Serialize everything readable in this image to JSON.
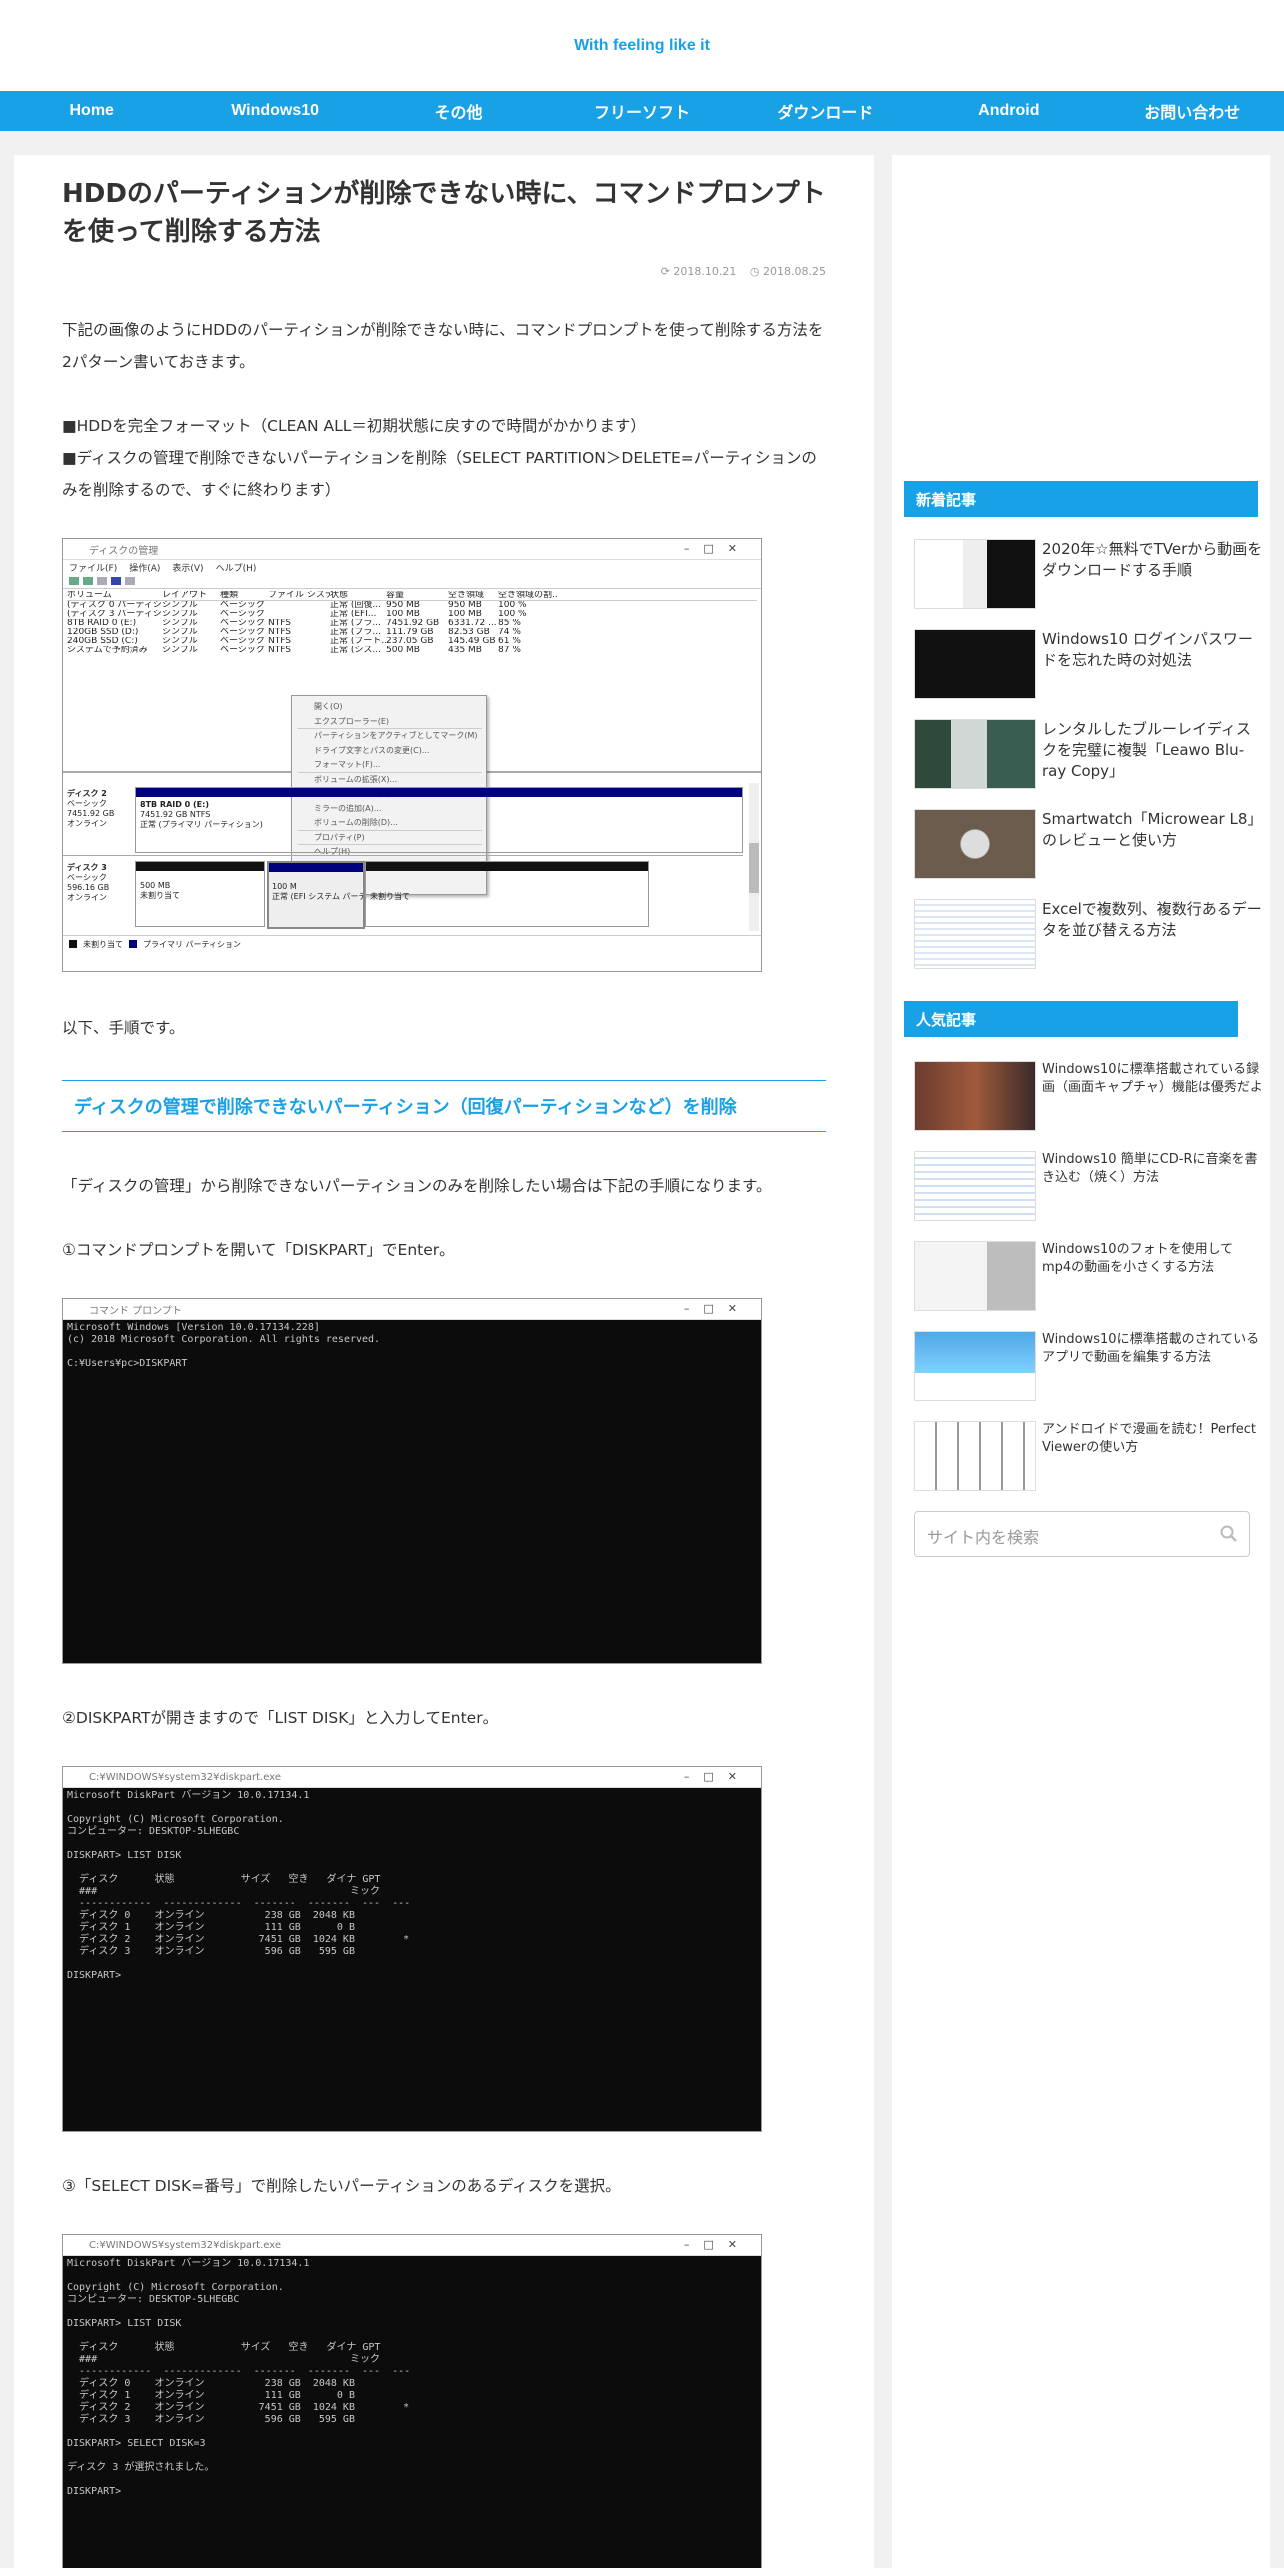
{
  "header": {
    "site_title": "With feeling like it"
  },
  "nav": {
    "items": [
      "Home",
      "Windows10",
      "その他",
      "フリーソフト",
      "ダウンロード",
      "Android",
      "お問い合わせ"
    ]
  },
  "post": {
    "title": "HDDのパーティションが削除できない時に、コマンドプロンプトを使って削除する方法",
    "updated": "2018.10.21",
    "published": "2018.08.25",
    "intro": "下記の画像のようにHDDのパーティションが削除できない時に、コマンドプロンプトを使って削除する方法を2パターン書いておきます。",
    "bullet1": "■HDDを完全フォーマット（CLEAN ALL＝初期状態に戻すので時間がかかります）",
    "bullet2": "■ディスクの管理で削除できないパーティションを削除（SELECT PARTITION＞DELETE=パーティションのみを削除するので、すぐに終わります）",
    "steps_intro": "以下、手順です。",
    "h2": "ディスクの管理で削除できないパーティション（回復パーティションなど）を削除",
    "h2_intro": "「ディスクの管理」から削除できないパーティションのみを削除したい場合は下記の手順になります。",
    "step1": "①コマンドプロンプトを開いて「DISKPART」でEnter。",
    "step2": "②DISKPARTが開きますので「LIST DISK」と入力してEnter。",
    "step3": "③「SELECT DISK=番号」で削除したいパーティションのあるディスクを選択。"
  },
  "diskmgmt": {
    "title": "ディスクの管理",
    "menu": [
      "ファイル(F)",
      "操作(A)",
      "表示(V)",
      "ヘルプ(H)"
    ],
    "columns": [
      "ボリューム",
      "レイアウト",
      "種類",
      "ファイル システム",
      "状態",
      "容量",
      "空き領域",
      "空き領域の割..."
    ],
    "rows": [
      [
        "(ディスク 0 パーティシ...",
        "シンプル",
        "ベーシック",
        "",
        "正常 (回復...",
        "950 MB",
        "950 MB",
        "100 %"
      ],
      [
        "(ディスク 3 パーティシ...",
        "シンプル",
        "ベーシック",
        "",
        "正常 (EFI...",
        "100 MB",
        "100 MB",
        "100 %"
      ],
      [
        "8TB RAID 0 (E:)",
        "シンプル",
        "ベーシック",
        "NTFS",
        "正常 (プラ...",
        "7451.92 GB",
        "6331.72 ...",
        "85 %"
      ],
      [
        "120GB SSD (D:)",
        "シンプル",
        "ベーシック",
        "NTFS",
        "正常 (プラ...",
        "111.79 GB",
        "82.53 GB",
        "74 %"
      ],
      [
        "240GB SSD (C:)",
        "シンプル",
        "ベーシック",
        "NTFS",
        "正常 (ブート...",
        "237.05 GB",
        "145.49 GB",
        "61 %"
      ],
      [
        "システムで予約済み",
        "シンプル",
        "ベーシック",
        "NTFS",
        "正常 (シス...",
        "500 MB",
        "435 MB",
        "87 %"
      ]
    ],
    "context_menu": [
      "開く(O)",
      "エクスプローラー(E)",
      "パーティションをアクティブとしてマーク(M)",
      "ドライブ文字とパスの変更(C)...",
      "フォーマット(F)...",
      "ボリュームの拡張(X)...",
      "ボリュームの縮小(H)...",
      "ミラーの追加(A)...",
      "ボリュームの削除(D)...",
      "プロパティ(P)",
      "ヘルプ(H)"
    ],
    "disk2": {
      "name": "ディスク 2",
      "type": "ベーシック",
      "size": "7451.92 GB",
      "status": "オンライン",
      "vol": "8TB RAID 0 (E:)",
      "vol_size": "7451.92 GB NTFS",
      "vol_status": "正常 (プライマリ パーティション)"
    },
    "disk3": {
      "name": "ディスク 3",
      "type": "ベーシック",
      "size": "596.16 GB",
      "status": "オンライン",
      "p1": "500 MB",
      "p1s": "未割り当て",
      "p2": "100 M",
      "p2s": "正常 (EFI システム パーテ",
      "p3s": "未割り当て"
    },
    "legend": [
      "未割り当て",
      "プライマリ パーティション"
    ]
  },
  "shot1": {
    "title": "コマンド プロンプト",
    "text": "Microsoft Windows [Version 10.0.17134.228]\n(c) 2018 Microsoft Corporation. All rights reserved.\n\nC:¥Users¥pc>DISKPART"
  },
  "shot2": {
    "title": "C:¥WINDOWS¥system32¥diskpart.exe",
    "text": "Microsoft DiskPart バージョン 10.0.17134.1\n\nCopyright (C) Microsoft Corporation.\nコンピューター: DESKTOP-5LHEGBC\n\nDISKPART> LIST DISK\n\n  ディスク      状態           サイズ   空き   ダイナ GPT\n  ###                                          ミック\n  ------------  -------------  -------  -------  ---  ---\n  ディスク 0    オンライン          238 GB  2048 KB\n  ディスク 1    オンライン          111 GB      0 B\n  ディスク 2    オンライン         7451 GB  1024 KB        *\n  ディスク 3    オンライン          596 GB   595 GB\n\nDISKPART>"
  },
  "shot3": {
    "title": "C:¥WINDOWS¥system32¥diskpart.exe",
    "text": "Microsoft DiskPart バージョン 10.0.17134.1\n\nCopyright (C) Microsoft Corporation.\nコンピューター: DESKTOP-5LHEGBC\n\nDISKPART> LIST DISK\n\n  ディスク      状態           サイズ   空き   ダイナ GPT\n  ###                                          ミック\n  ------------  -------------  -------  -------  ---  ---\n  ディスク 0    オンライン          238 GB  2048 KB\n  ディスク 1    オンライン          111 GB      0 B\n  ディスク 2    オンライン         7451 GB  1024 KB        *\n  ディスク 3    オンライン          596 GB   595 GB\n\nDISKPART> SELECT DISK=3\n\nディスク 3 が選択されました。\n\nDISKPART>"
  },
  "sidebar": {
    "recent_title": "新着記事",
    "recent": [
      "2020年☆無料でTVerから動画をダウンロードする手順",
      "Windows10 ログインパスワードを忘れた時の対処法",
      "レンタルしたブルーレイディスクを完璧に複製「Leawo Blu-ray Copy」",
      "Smartwatch「Microwear L8」のレビューと使い方",
      "Excelで複数列、複数行あるデータを並び替える方法"
    ],
    "popular_title": "人気記事",
    "popular": [
      "Windows10に標準搭載されている録画（画面キャプチャ）機能は優秀だよ",
      "Windows10 簡単にCD-Rに音楽を書き込む（焼く）方法",
      "Windows10のフォトを使用して mp4の動画を小さくする方法",
      "Windows10に標準搭載のされているアプリで動画を編集する方法",
      "アンドロイドで漫画を読む！Perfect Viewerの使い方"
    ],
    "search_placeholder": "サイト内を検索"
  },
  "colors": {
    "accent": "#19a1e5",
    "site_title": "#1aa0e6"
  }
}
